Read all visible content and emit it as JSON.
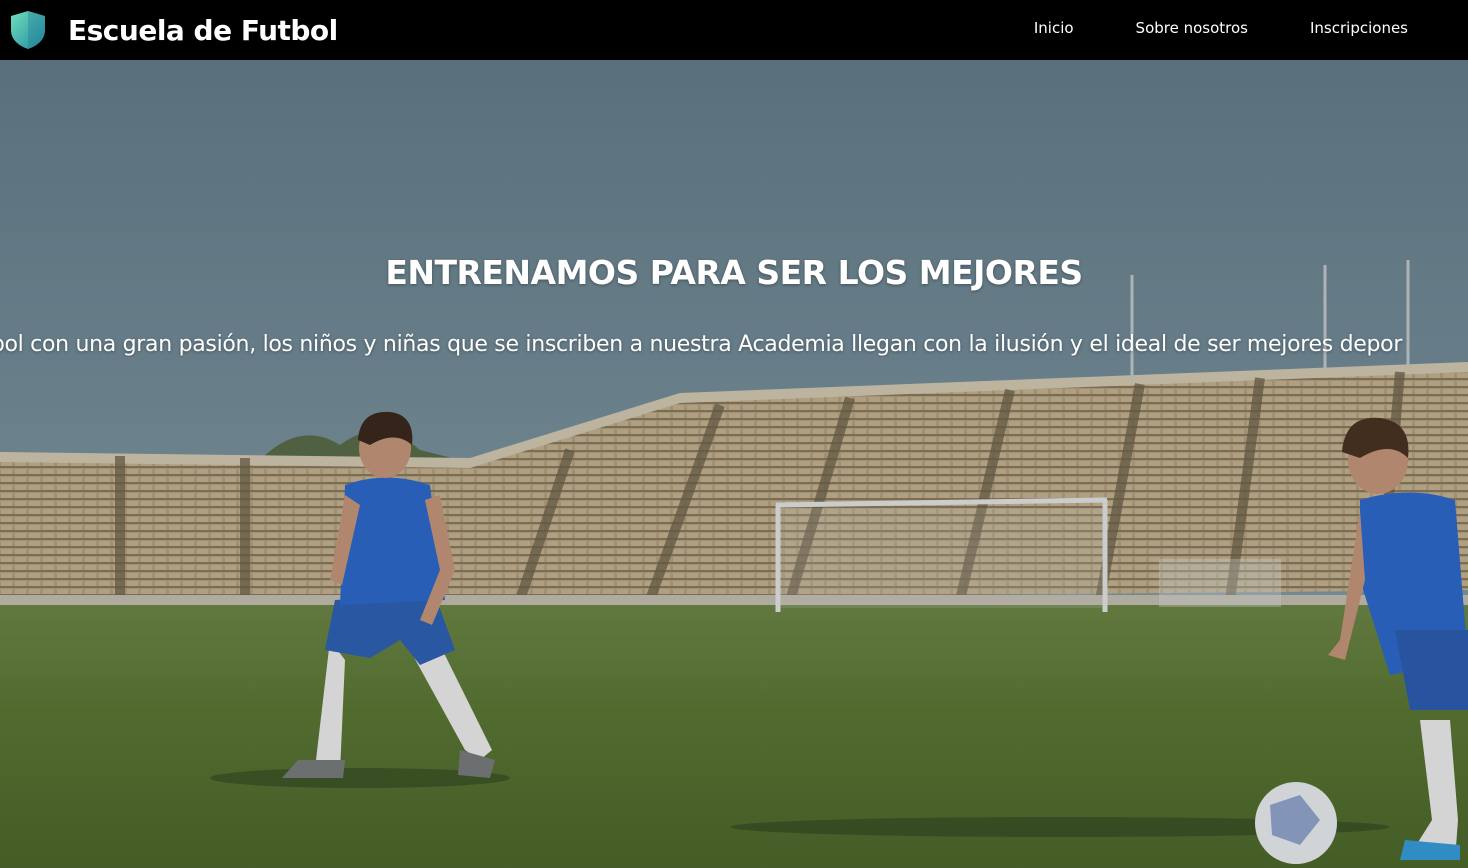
{
  "navbar": {
    "brand": {
      "logo_icon": "shield-icon",
      "title": "Escuela de Futbol"
    },
    "links": [
      {
        "label": "Inicio"
      },
      {
        "label": "Sobre nosotros"
      },
      {
        "label": "Inscripciones"
      }
    ]
  },
  "hero": {
    "title": "ENTRENAMOS PARA SER LOS MEJORES",
    "text": "…el fútbol con una gran pasión, los niños y niñas que se inscriben a nuestra Academia llegan con la ilusión y el ideal de ser mejores depor"
  },
  "colors": {
    "navbar_bg": "#000000",
    "shield_light": "#5fd3b4",
    "shield_dark": "#2a8fa3",
    "text": "#ffffff"
  }
}
